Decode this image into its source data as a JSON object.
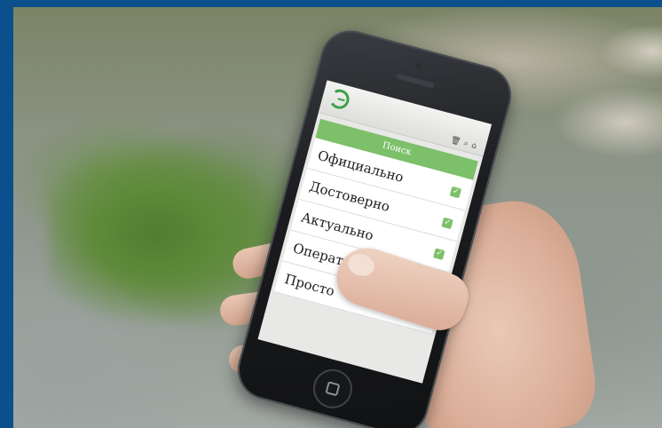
{
  "app": {
    "search_label": "Поиск",
    "header_icons": [
      "trash-icon",
      "search-icon",
      "home-icon"
    ],
    "items": [
      {
        "label": "Официально",
        "checked": true
      },
      {
        "label": "Достоверно",
        "checked": true
      },
      {
        "label": "Актуально",
        "checked": true
      },
      {
        "label": "Оперативно",
        "checked": false
      },
      {
        "label": "Просто",
        "checked": false
      }
    ]
  },
  "colors": {
    "frame": "#0b4f8c",
    "accent_green": "#7cc06a",
    "logo_green": "#3aa14a"
  }
}
